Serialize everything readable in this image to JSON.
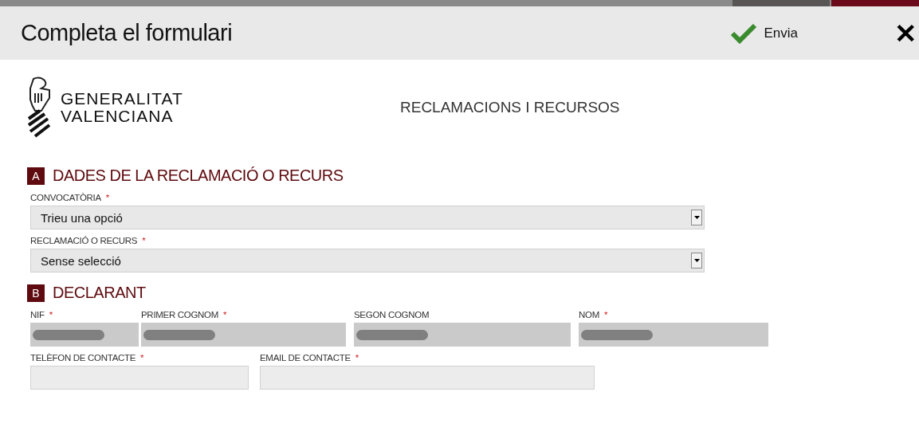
{
  "header": {
    "title": "Completa el formulari",
    "submit": "Envia",
    "close": "✕"
  },
  "org": {
    "line1": "GENERALITAT",
    "line2": "VALENCIANA"
  },
  "required_symbol": "*",
  "form_title": "RECLAMACIONS I RECURSOS",
  "sections": [
    {
      "letter": "A",
      "title": "DADES DE LA RECLAMACIÓ O RECURS",
      "rows": [
        [
          {
            "kind": "select",
            "label": "CONVOCATÒRIA",
            "required": true,
            "value": "Trieu una opció"
          }
        ],
        [
          {
            "kind": "select",
            "label": "RECLAMACIÓ O RECURS",
            "required": true,
            "value": "Sense selecció"
          }
        ]
      ]
    },
    {
      "letter": "B",
      "title": "DECLARANT",
      "rows": [
        [
          {
            "kind": "text",
            "label": "NIF",
            "required": true,
            "redacted": true
          },
          {
            "kind": "text",
            "label": "PRIMER COGNOM",
            "required": true,
            "redacted": true
          },
          {
            "kind": "text",
            "label": "SEGON COGNOM",
            "required": false,
            "redacted": true
          },
          {
            "kind": "text",
            "label": "NOM",
            "required": true,
            "redacted": true
          }
        ],
        [
          {
            "kind": "text",
            "label": "TELÈFON DE CONTACTE",
            "required": true,
            "redacted": false
          },
          {
            "kind": "text",
            "label": "EMAIL DE CONTACTE",
            "required": true,
            "redacted": false
          }
        ]
      ]
    }
  ]
}
